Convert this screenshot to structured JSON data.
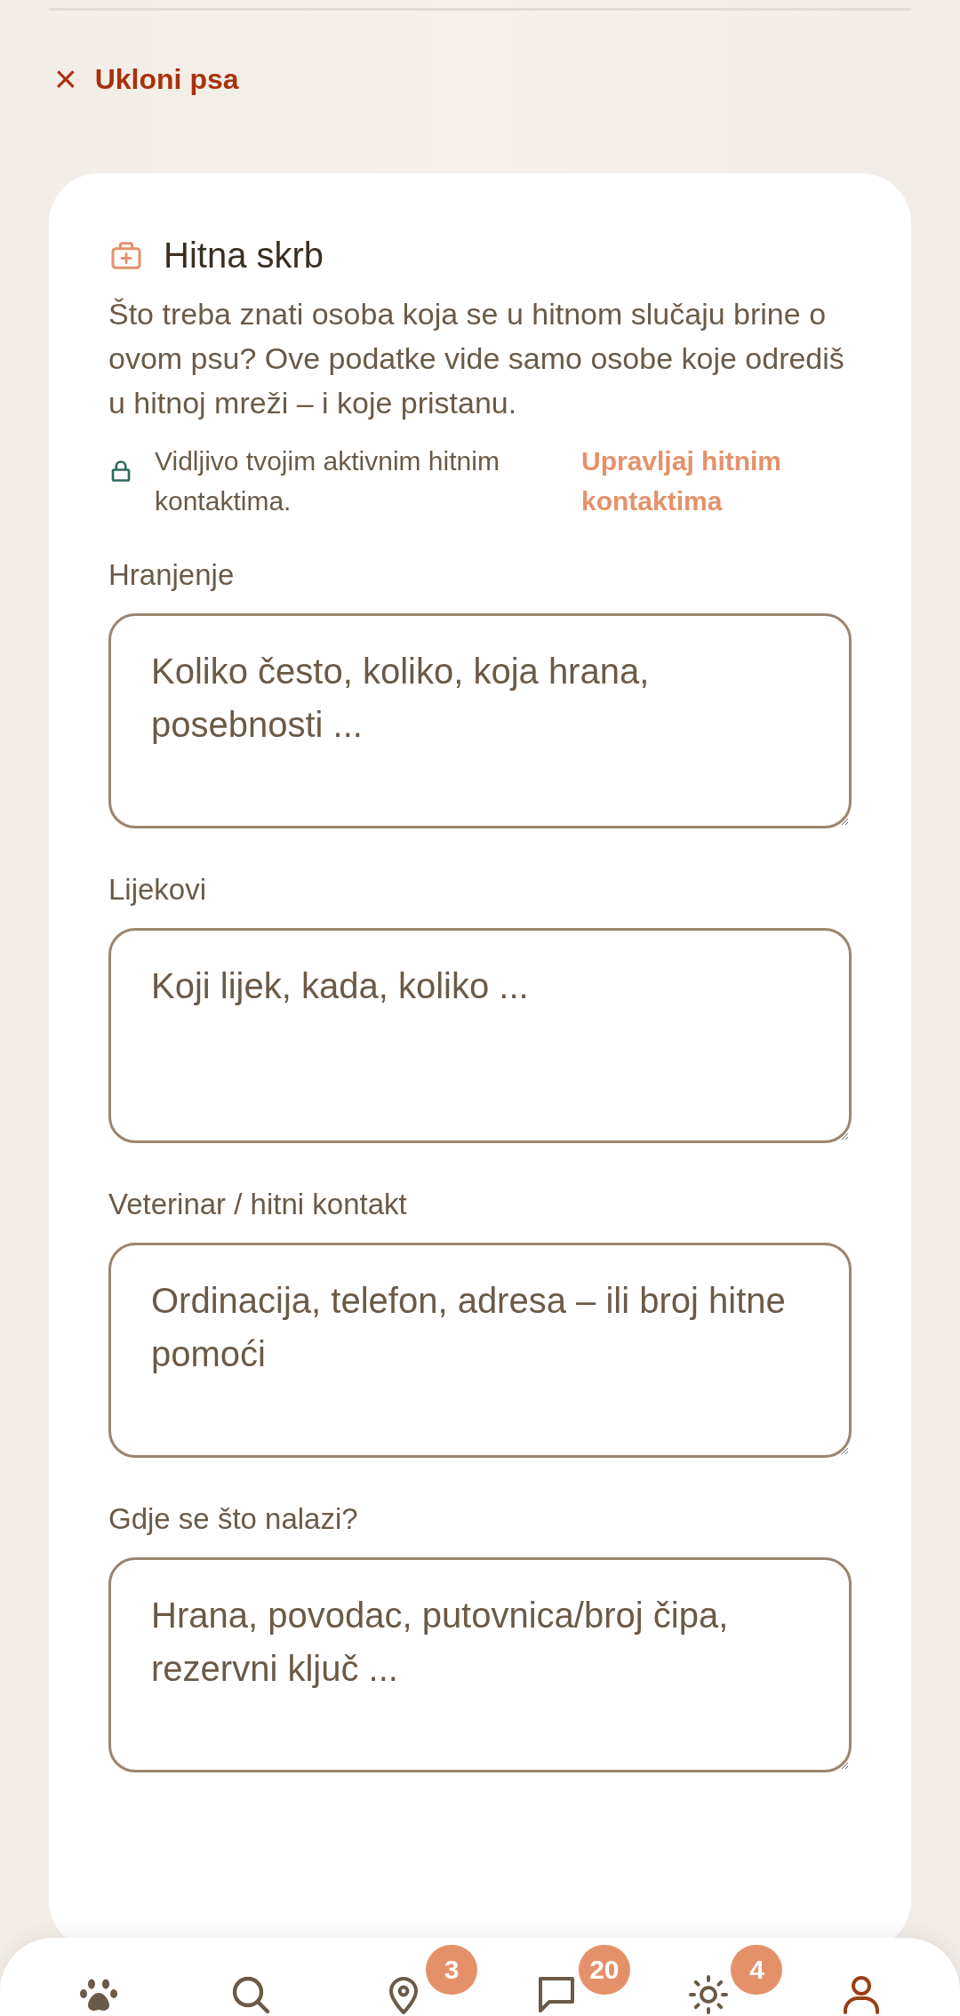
{
  "remove_link": {
    "icon": "×",
    "label": "Ukloni psa"
  },
  "card": {
    "title": "Hitna skrb",
    "description": "Što treba znati osoba koja se u hitnom slučaju brine o ovom psu? Ove podatke vide samo osobe koje odrediš u hitnoj mreži – i koje pristanu.",
    "visibility_note": "Vidljivo tvojim aktivnim hitnim kontaktima.",
    "manage_link": "Upravljaj hitnim kontaktima",
    "fields": [
      {
        "label": "Hranjenje",
        "placeholder": "Koliko često, koliko, koja hrana, posebnosti ..."
      },
      {
        "label": "Lijekovi",
        "placeholder": "Koji lijek, kada, koliko ..."
      },
      {
        "label": "Veterinar / hitni kontakt",
        "placeholder": "Ordinacija, telefon, adresa – ili broj hitne pomoći"
      },
      {
        "label": "Gdje se što nalazi?",
        "placeholder": "Hrana, povodac, putovnica/broj čipa, rezervni ključ ..."
      }
    ]
  },
  "bottom_nav": [
    {
      "kind": "paw",
      "selected": false
    },
    {
      "kind": "search",
      "selected": false
    },
    {
      "kind": "pin",
      "selected": false,
      "badge": "3"
    },
    {
      "kind": "chat",
      "selected": false,
      "badge": "20"
    },
    {
      "kind": "sun",
      "selected": false,
      "badge": "4"
    },
    {
      "kind": "profile",
      "selected": true
    }
  ]
}
